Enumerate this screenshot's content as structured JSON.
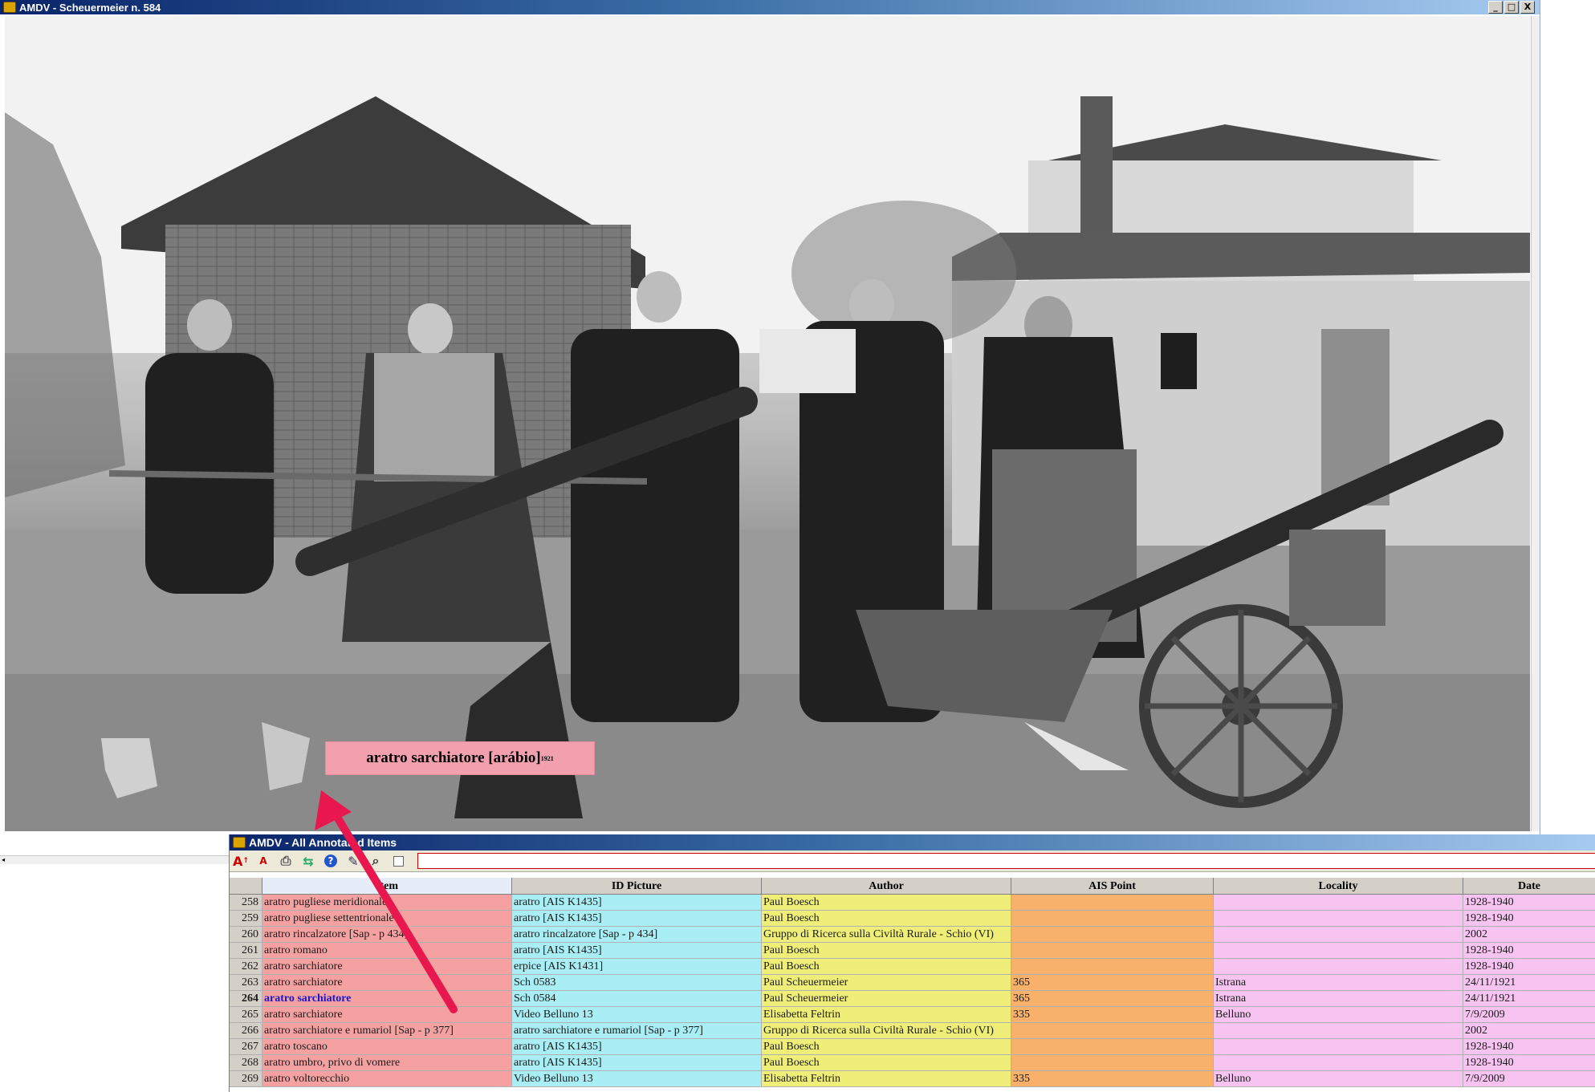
{
  "image_window": {
    "title": "AMDV - Scheuermeier n. 584",
    "buttons": [
      "_",
      "□",
      "X"
    ]
  },
  "annotation": {
    "label": "aratro sarchiatore [arábio]",
    "superscript": "1921"
  },
  "table_window": {
    "title": "AMDV - All Annotated Items",
    "toolbar_icons": [
      "font-increase-icon",
      "font-decrease-icon",
      "print-icon",
      "export-icon",
      "help-icon",
      "edit-icon",
      "search-icon",
      "checkbox-icon"
    ],
    "search_value": ""
  },
  "table": {
    "columns": [
      "Item",
      "ID Picture",
      "Author",
      "AIS Point",
      "Locality",
      "Date"
    ],
    "rows": [
      {
        "n": "258",
        "item": "aratro pugliese meridionale",
        "id": "aratro [AIS K1435]",
        "author": "Paul Boesch",
        "ais": "",
        "loc": "",
        "date": "1928-1940"
      },
      {
        "n": "259",
        "item": "aratro pugliese settentrionale",
        "id": "aratro [AIS K1435]",
        "author": "Paul Boesch",
        "ais": "",
        "loc": "",
        "date": "1928-1940"
      },
      {
        "n": "260",
        "item": "aratro rincalzatore [Sap - p 434]",
        "id": "aratro rincalzatore [Sap - p 434]",
        "author": "Gruppo di Ricerca sulla Civiltà Rurale - Schio (VI)",
        "ais": "",
        "loc": "",
        "date": "2002"
      },
      {
        "n": "261",
        "item": "aratro romano",
        "id": "aratro [AIS K1435]",
        "author": "Paul Boesch",
        "ais": "",
        "loc": "",
        "date": "1928-1940"
      },
      {
        "n": "262",
        "item": "aratro sarchiatore",
        "id": "erpice [AIS K1431]",
        "author": "Paul Boesch",
        "ais": "",
        "loc": "",
        "date": "1928-1940"
      },
      {
        "n": "263",
        "item": "aratro sarchiatore",
        "id": "Sch 0583",
        "author": "Paul Scheuermeier",
        "ais": "365",
        "loc": "Istrana",
        "date": "24/11/1921"
      },
      {
        "n": "264",
        "item": "aratro sarchiatore",
        "id": "Sch 0584",
        "author": "Paul Scheuermeier",
        "ais": "365",
        "loc": "Istrana",
        "date": "24/11/1921"
      },
      {
        "n": "265",
        "item": "aratro sarchiatore",
        "id": "Video Belluno 13",
        "author": "Elisabetta Feltrin",
        "ais": "335",
        "loc": "Belluno",
        "date": "7/9/2009"
      },
      {
        "n": "266",
        "item": "aratro sarchiatore e rumariol [Sap - p 377]",
        "id": "aratro sarchiatore e rumariol [Sap - p 377]",
        "author": "Gruppo di Ricerca sulla Civiltà Rurale - Schio (VI)",
        "ais": "",
        "loc": "",
        "date": "2002"
      },
      {
        "n": "267",
        "item": "aratro toscano",
        "id": "aratro [AIS K1435]",
        "author": "Paul Boesch",
        "ais": "",
        "loc": "",
        "date": "1928-1940"
      },
      {
        "n": "268",
        "item": "aratro umbro, privo di vomere",
        "id": "aratro [AIS K1435]",
        "author": "Paul Boesch",
        "ais": "",
        "loc": "",
        "date": "1928-1940"
      },
      {
        "n": "269",
        "item": "aratro voltorecchio",
        "id": "Video Belluno 13",
        "author": "Elisabetta Feltrin",
        "ais": "335",
        "loc": "Belluno",
        "date": "7/9/2009"
      }
    ],
    "selected_row": "264"
  },
  "colors": {
    "item": "#f5a1a1",
    "id_picture": "#a8eef4",
    "author": "#eeee78",
    "ais_point": "#f7b16a",
    "locality": "#f7c4f2",
    "arrow": "#e8184e"
  }
}
